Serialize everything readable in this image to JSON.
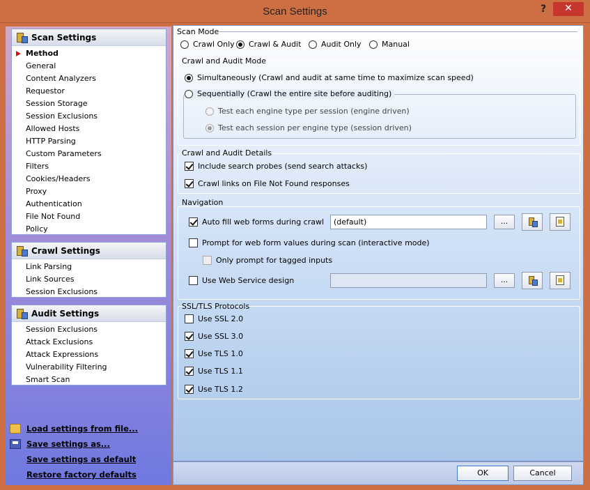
{
  "window": {
    "title": "Scan Settings",
    "help": "?",
    "close": "✕"
  },
  "sidebar": {
    "scan_settings": {
      "title": "Scan Settings",
      "items": [
        "Method",
        "General",
        "Content Analyzers",
        "Requestor",
        "Session Storage",
        "Session Exclusions",
        "Allowed Hosts",
        "HTTP Parsing",
        "Custom Parameters",
        "Filters",
        "Cookies/Headers",
        "Proxy",
        "Authentication",
        "File Not Found",
        "Policy"
      ]
    },
    "crawl_settings": {
      "title": "Crawl Settings",
      "items": [
        "Link Parsing",
        "Link Sources",
        "Session Exclusions"
      ]
    },
    "audit_settings": {
      "title": "Audit Settings",
      "items": [
        "Session Exclusions",
        "Attack Exclusions",
        "Attack Expressions",
        "Vulnerability Filtering",
        "Smart Scan"
      ]
    },
    "links": [
      "Load settings from file...",
      "Save settings as...",
      "Save settings as default",
      "Restore factory defaults"
    ]
  },
  "scan_mode": {
    "label": "Scan Mode",
    "options": [
      "Crawl Only",
      "Crawl & Audit",
      "Audit Only",
      "Manual"
    ],
    "selected": "Crawl & Audit"
  },
  "crawl_audit_mode": {
    "label": "Crawl and Audit Mode",
    "simultaneous": "Simultaneously (Crawl and audit at same time to maximize scan speed)",
    "sequential": "Sequentially (Crawl the entire site before auditing)",
    "engine_driven": "Test each engine type per session (engine driven)",
    "session_driven": "Test each session per engine type (session driven)"
  },
  "crawl_audit_details": {
    "label": "Crawl and Audit Details",
    "search_probes": "Include search probes (send search attacks)",
    "crawl_links": "Crawl links on File Not Found responses"
  },
  "navigation": {
    "label": "Navigation",
    "auto_fill": "Auto fill web forms during crawl",
    "auto_fill_value": "(default)",
    "prompt": "Prompt for web form values during scan (interactive mode)",
    "only_tagged": "Only prompt for tagged inputs",
    "web_service": "Use Web Service design",
    "browse": "..."
  },
  "ssl": {
    "label": "SSL/TLS Protocols",
    "items": [
      "Use SSL 2.0",
      "Use SSL 3.0",
      "Use TLS 1.0",
      "Use TLS 1.1",
      "Use TLS 1.2"
    ]
  },
  "footer": {
    "ok": "OK",
    "cancel": "Cancel"
  }
}
